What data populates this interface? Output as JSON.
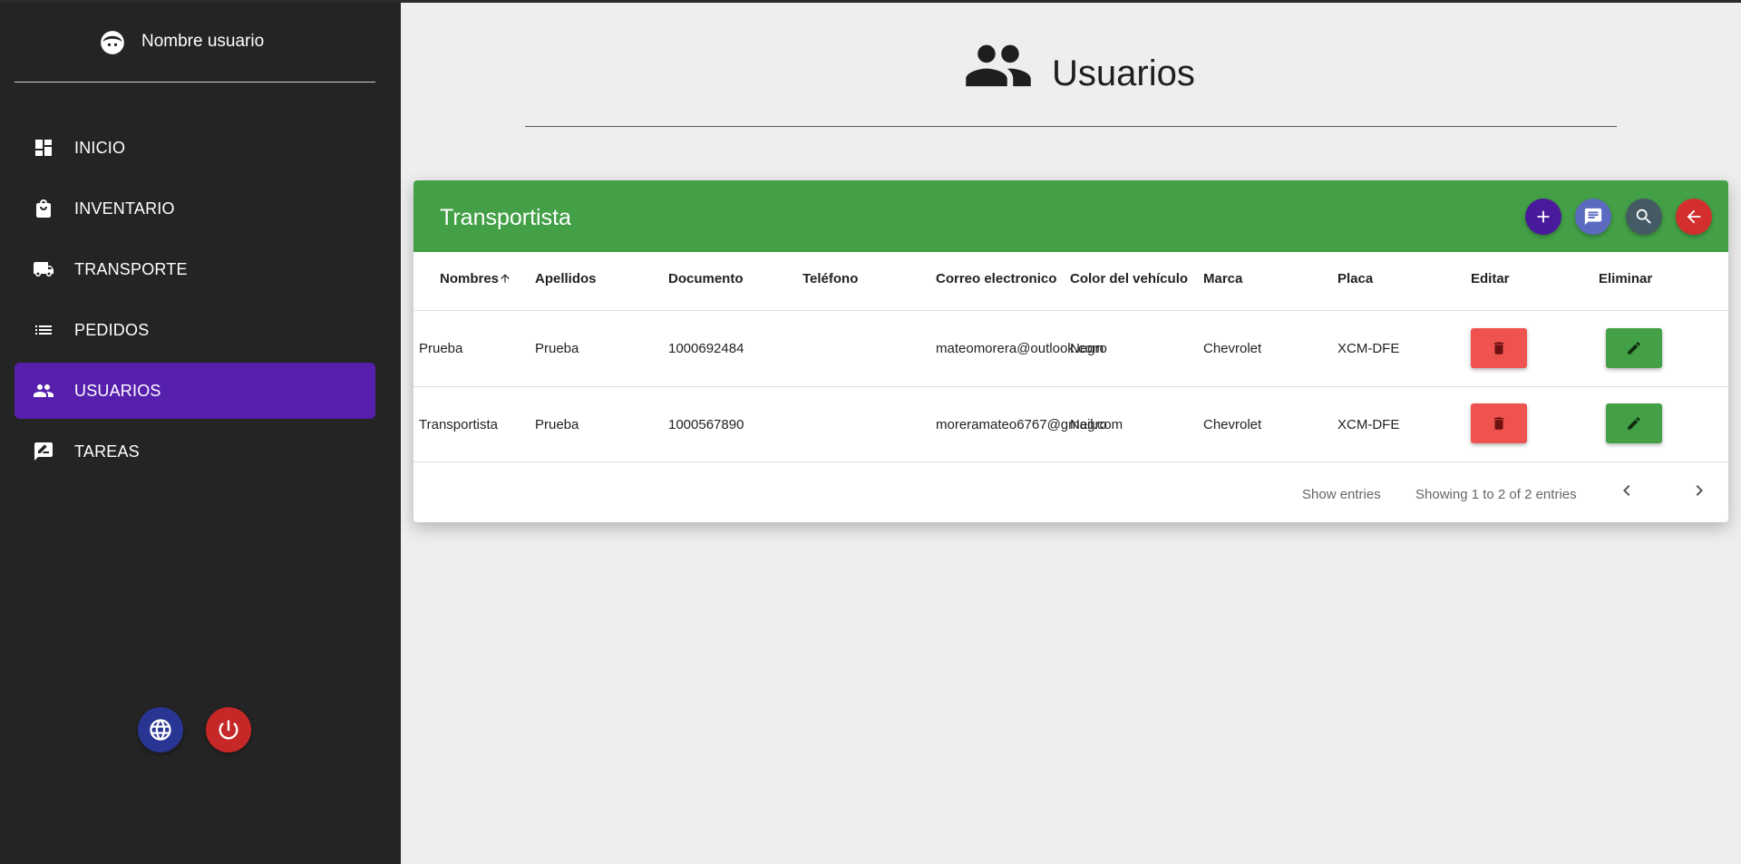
{
  "sidebar": {
    "user_name": "Nombre usuario",
    "items": [
      {
        "label": "INICIO",
        "icon": "dashboard-icon"
      },
      {
        "label": "INVENTARIO",
        "icon": "shopping-bag-icon"
      },
      {
        "label": "TRANSPORTE",
        "icon": "truck-icon"
      },
      {
        "label": "PEDIDOS",
        "icon": "list-icon"
      },
      {
        "label": "USUARIOS",
        "icon": "people-icon",
        "active": true
      },
      {
        "label": "TAREAS",
        "icon": "rate-review-icon"
      }
    ],
    "accent_color": "#5620ad"
  },
  "page": {
    "title": "Usuarios"
  },
  "table": {
    "title": "Transportista",
    "header_color": "#43a047",
    "columns": [
      "Nombres",
      "Apellidos",
      "Documento",
      "Teléfono",
      "Correo electronico",
      "Color del vehículo",
      "Marca",
      "Placa",
      "Editar",
      "Eliminar"
    ],
    "rows": [
      {
        "nombres": "Prueba",
        "apellidos": "Prueba",
        "documento": "1000692484",
        "telefono": "",
        "correo": "mateomorera@outlook.com",
        "color": "Negro",
        "marca": "Chevrolet",
        "placa": "XCM-DFE"
      },
      {
        "nombres": "Transportista",
        "apellidos": "Prueba",
        "documento": "1000567890",
        "telefono": "",
        "correo": "moreramateo6767@gmail.com",
        "color": "Negro",
        "marca": "Chevrolet",
        "placa": "XCM-DFE"
      }
    ],
    "footer": {
      "show_entries": "Show entries",
      "showing": "Showing 1 to 2 of 2 entries"
    }
  }
}
